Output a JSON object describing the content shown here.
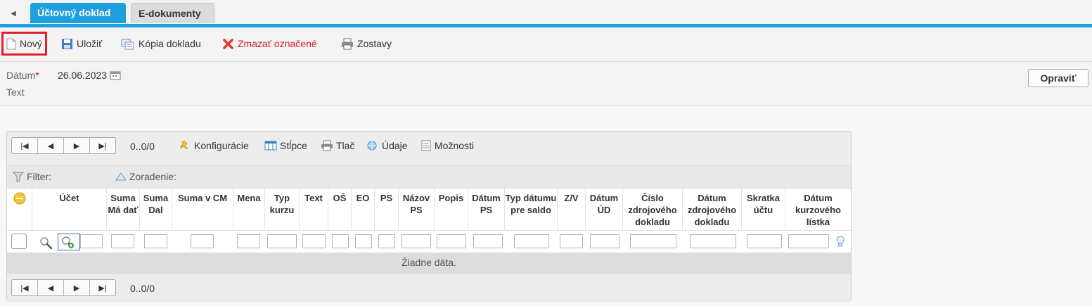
{
  "tabs": [
    {
      "label": "Účtovný doklad",
      "active": true
    },
    {
      "label": "E-dokumenty",
      "active": false
    }
  ],
  "toolbar": {
    "new_label": "Nový",
    "save_label": "Uložiť",
    "copy_label": "Kópia dokladu",
    "delete_label": "Zmazať označené",
    "reports_label": "Zostavy"
  },
  "form": {
    "date_label": "Dátum",
    "required_mark": "*",
    "date_value": "26.06.2023",
    "text_label": "Text",
    "fix_button": "Opraviť"
  },
  "grid": {
    "range": "0..0/0",
    "tools": {
      "config": "Konfigurácie",
      "columns": "Stĺpce",
      "print": "Tlač",
      "data": "Údaje",
      "options": "Možnosti"
    },
    "filter_label": "Filter:",
    "sort_label": "Zoradenie:",
    "columns": [
      "Účet",
      "Suma Má dať",
      "Suma Dal",
      "Suma v CM",
      "Mena",
      "Typ kurzu",
      "Text",
      "OŠ",
      "EO",
      "PS",
      "Názov PS",
      "Popis",
      "Dátum PS",
      "Typ dátumu pre saldo",
      "Z/V",
      "Dátum ÚD",
      "Číslo zdrojového dokladu",
      "Dátum zdrojového dokladu",
      "Skratka účtu",
      "Dátum kurzového lístka"
    ],
    "no_data": "Žiadne dáta.",
    "footer_range": "0..0/0"
  },
  "colors": {
    "accent": "#1f9fdc",
    "delete": "#d42020",
    "highlight": "#e0202c"
  }
}
